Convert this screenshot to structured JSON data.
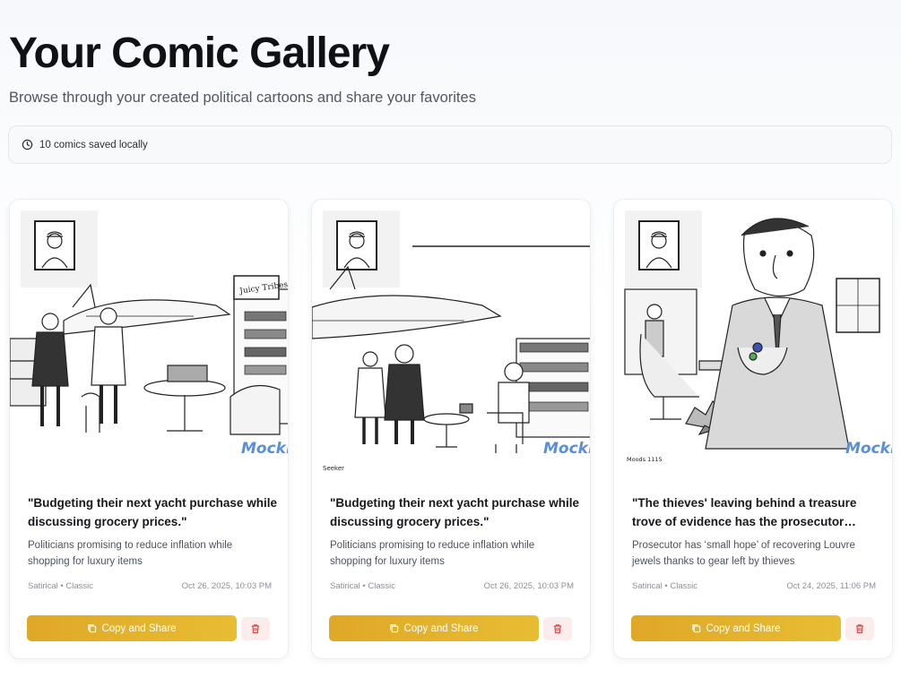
{
  "header": {
    "title": "Your Comic Gallery",
    "subtitle": "Browse through your created political cartoons and share your favorites"
  },
  "status": {
    "icon": "clock-icon",
    "text": "10 comics saved locally"
  },
  "colors": {
    "accent_start": "#dfa827",
    "accent_end": "#e7bd33",
    "delete_bg": "#fdecec",
    "delete_icon": "#e04848",
    "watermark": "#5a8fd6"
  },
  "cards": [
    {
      "title": "\"Budgeting their next yacht purchase while discussing grocery prices.\"",
      "description": "Politicians promising to reduce inflation while shopping for luxury items",
      "style": "Satirical • Classic",
      "date": "Oct 26, 2025, 10:03 PM",
      "copy_label": "Copy and Share",
      "watermark": "Mockr",
      "sign_text": "Juicy Tribes"
    },
    {
      "title": "\"Budgeting their next yacht purchase while discussing grocery prices.\"",
      "description": "Politicians promising to reduce inflation while shopping for luxury items",
      "style": "Satirical • Classic",
      "date": "Oct 26, 2025, 10:03 PM",
      "copy_label": "Copy and Share",
      "watermark": "Mockr",
      "signature": "Seeker"
    },
    {
      "title": "\"The thieves' leaving behind a treasure trove of evidence has the prosecutor…",
      "description": "Prosecutor has ‘small hope’ of recovering Louvre jewels thanks to gear left by thieves",
      "style": "Satirical • Classic",
      "date": "Oct 24, 2025, 11:06 PM",
      "copy_label": "Copy and Share",
      "watermark": "Mockr",
      "signature": "Moods 1115"
    }
  ]
}
